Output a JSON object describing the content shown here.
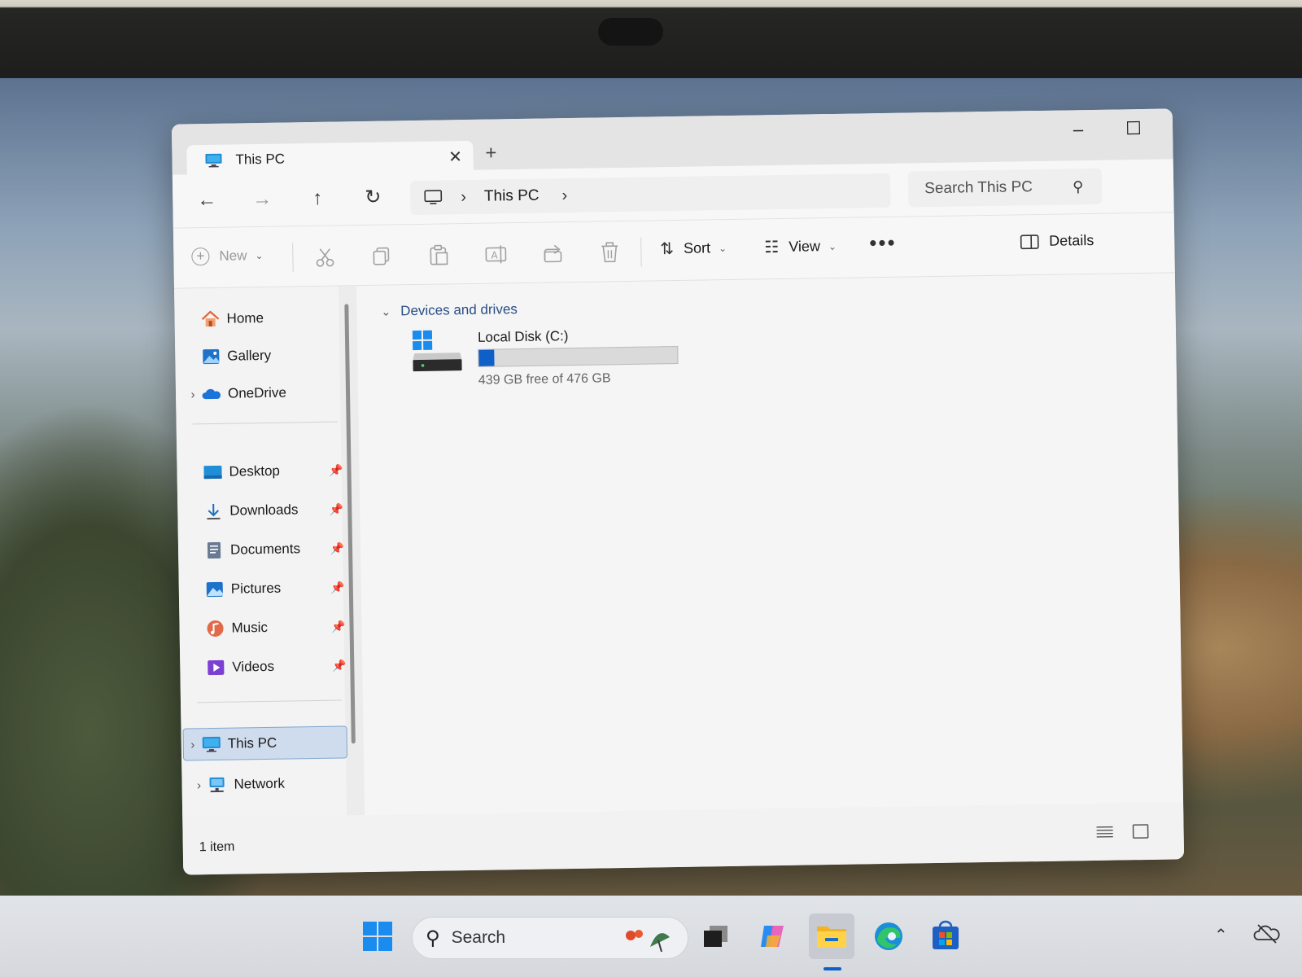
{
  "window": {
    "tab_title": "This PC",
    "new_tab_label": "+",
    "caption": {
      "minimize": "–",
      "maximize": "☐",
      "close": "✕"
    }
  },
  "nav": {
    "breadcrumb": [
      "This PC"
    ],
    "search_placeholder": "Search This PC"
  },
  "toolbar": {
    "new_label": "New",
    "sort_label": "Sort",
    "view_label": "View",
    "more_label": "•••",
    "details_label": "Details",
    "action_icons": [
      "cut-icon",
      "copy-icon",
      "paste-icon",
      "rename-icon",
      "share-icon",
      "delete-icon"
    ]
  },
  "sidebar": {
    "top_items": [
      {
        "label": "Home",
        "icon": "home-icon"
      },
      {
        "label": "Gallery",
        "icon": "gallery-icon"
      },
      {
        "label": "OneDrive",
        "icon": "onedrive-icon",
        "expandable": true
      }
    ],
    "pinned_items": [
      {
        "label": "Desktop",
        "icon": "desktop-icon"
      },
      {
        "label": "Downloads",
        "icon": "downloads-icon"
      },
      {
        "label": "Documents",
        "icon": "documents-icon"
      },
      {
        "label": "Pictures",
        "icon": "pictures-icon"
      },
      {
        "label": "Music",
        "icon": "music-icon"
      },
      {
        "label": "Videos",
        "icon": "videos-icon"
      }
    ],
    "bottom_items": [
      {
        "label": "This PC",
        "icon": "this-pc-icon",
        "selected": true
      },
      {
        "label": "Network",
        "icon": "network-icon"
      }
    ]
  },
  "content": {
    "group_title": "Devices and drives",
    "drives": [
      {
        "name": "Local Disk (C:)",
        "free_text": "439 GB free of 476 GB",
        "used_fraction": 0.078
      }
    ]
  },
  "status": {
    "item_count": "1 item"
  },
  "taskbar": {
    "search_label": "Search",
    "apps": [
      "start-icon",
      "task-view-icon",
      "copilot-icon",
      "file-explorer-icon",
      "edge-icon",
      "store-icon"
    ]
  },
  "colors": {
    "accent": "#0f5fc9",
    "selected_bg": "#cfdced",
    "group_header": "#2a4e86"
  }
}
